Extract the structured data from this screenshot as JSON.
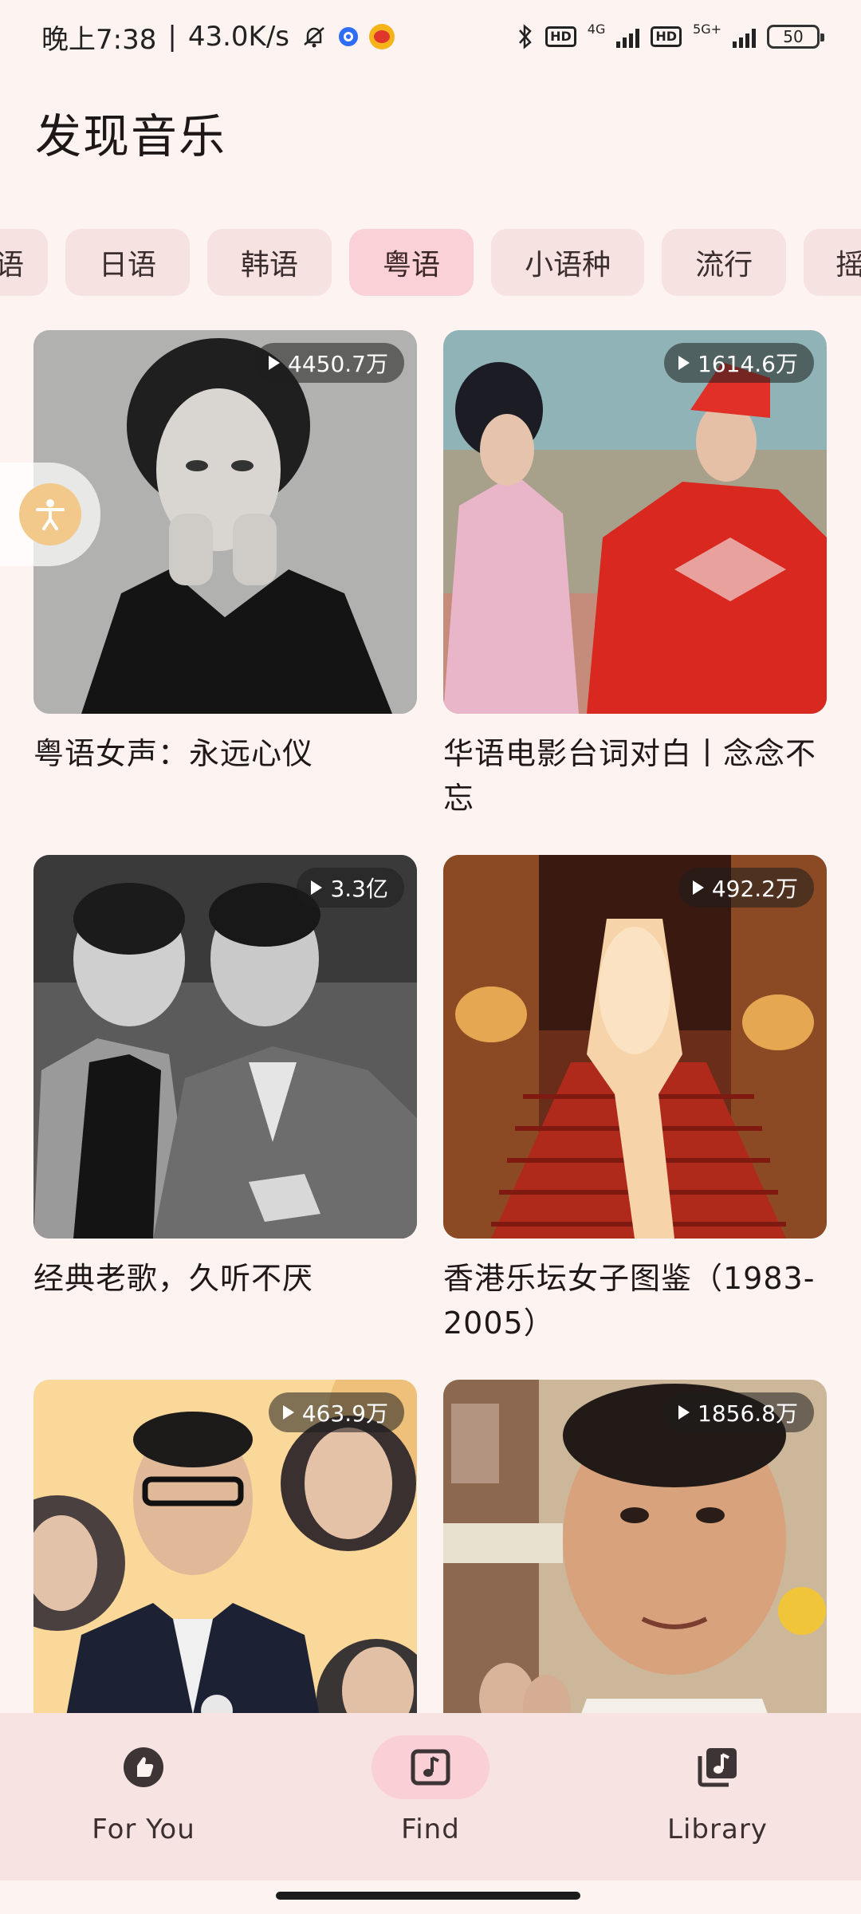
{
  "status_bar": {
    "time": "晚上7:38",
    "speed": "43.0K/s",
    "net1": "4G",
    "net2": "5G+",
    "hd": "HD",
    "battery": "50"
  },
  "page_title": "发现音乐",
  "chips": [
    "语",
    "日语",
    "韩语",
    "粤语",
    "小语种",
    "流行",
    "摇"
  ],
  "active_chip": "粤语",
  "playlists": [
    {
      "plays": "4450.7万",
      "title": "粤语女声：永远心仪"
    },
    {
      "plays": "1614.6万",
      "title": "华语电影台词对白丨念念不忘"
    },
    {
      "plays": "3.3亿",
      "title": "经典老歌，久听不厌"
    },
    {
      "plays": "492.2万",
      "title": "香港乐坛女子图鉴（1983-2005）"
    },
    {
      "plays": "463.9万",
      "title": ""
    },
    {
      "plays": "1856.8万",
      "title": ""
    }
  ],
  "nav": {
    "for_you": "For You",
    "find": "Find",
    "library": "Library"
  },
  "colors": {
    "background": "#fdf3f1",
    "chip": "#f5e2e1",
    "chip_active": "#fbd1d8",
    "nav_bg": "#f8e3e3"
  }
}
